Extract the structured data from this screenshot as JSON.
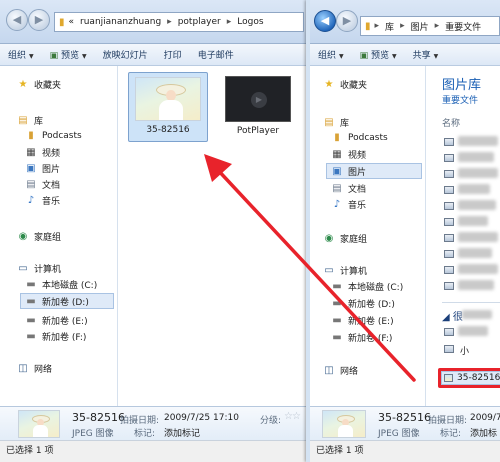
{
  "colors": {
    "accent": "#1a5fb4",
    "arrow": "#e8232b",
    "selection": "#dfeaf8"
  },
  "left": {
    "address": {
      "prefix": "«",
      "parts": [
        "ruanjiananzhuang",
        "potplayer",
        "Logos"
      ]
    },
    "toolbar": {
      "organize": "组织",
      "preview": "预览",
      "slideshow": "放映幻灯片",
      "print": "打印",
      "email": "电子邮件"
    },
    "nav": {
      "favorites": "收藏夹",
      "library": "库",
      "podcasts": "Podcasts",
      "video": "视频",
      "pictures": "图片",
      "documents": "文档",
      "music": "音乐",
      "homegroup": "家庭组",
      "computer": "计算机",
      "drive_c": "本地磁盘 (C:)",
      "drive_d": "新加卷 (D:)",
      "drive_e": "新加卷 (E:)",
      "drive_f": "新加卷 (F:)",
      "network": "网络"
    },
    "files": [
      {
        "name": "35-82516"
      },
      {
        "name": "PotPlayer"
      }
    ],
    "details": {
      "name": "35-82516",
      "type": "JPEG 图像",
      "date_label": "拍摄日期:",
      "date_value": "2009/7/25 17:10",
      "tags_label": "标记:",
      "tags_value": "添加标记",
      "rating_label": "分级:"
    },
    "status": "已选择 1 项"
  },
  "right": {
    "address": {
      "parts": [
        "库",
        "图片",
        "重要文件"
      ]
    },
    "toolbar": {
      "organize": "组织",
      "preview": "预览",
      "share": "共享"
    },
    "library_title": "图片库",
    "library_subtitle": "重要文件",
    "col_name": "名称",
    "nav": {
      "favorites": "收藏夹",
      "library": "库",
      "podcasts": "Podcasts",
      "video": "视频",
      "pictures": "图片",
      "documents": "文档",
      "music": "音乐",
      "homegroup": "家庭组",
      "computer": "计算机",
      "drive_c": "本地磁盘 (C:)",
      "drive_d": "新加卷 (D:)",
      "drive_e": "新加卷 (E:)",
      "drive_f": "新加卷 (F:)",
      "network": "网络"
    },
    "group_label": "很",
    "small_label": "小",
    "highlighted_file": "35-82516",
    "details": {
      "name": "35-82516",
      "type": "JPEG 图像",
      "date_label": "拍摄日期:",
      "date_value": "2009/7/",
      "tags_label": "标记:",
      "tags_value": "添加标记"
    },
    "status": "已选择 1 项"
  }
}
